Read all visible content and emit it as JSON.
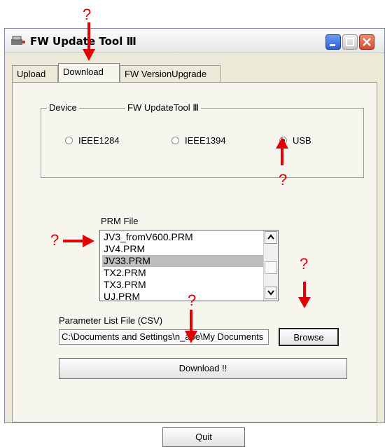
{
  "window": {
    "title": "FW Update Tool Ⅲ"
  },
  "tabs": [
    "Upload",
    "Download",
    "FW VersionUpgrade"
  ],
  "group": {
    "left_legend": "Device",
    "right_legend": "FW UpdateTool Ⅲ",
    "radios": [
      {
        "label": "IEEE1284",
        "checked": false
      },
      {
        "label": "IEEE1394",
        "checked": false
      },
      {
        "label": "USB",
        "checked": true
      }
    ]
  },
  "prm": {
    "label": "PRM File",
    "items": [
      "JV3_fromV600.PRM",
      "JV4.PRM",
      "JV33.PRM",
      "TX2.PRM",
      "TX3.PRM",
      "UJ.PRM"
    ],
    "selected": "JV33.PRM"
  },
  "param": {
    "label": "Parameter List File (CSV)",
    "path": "C:\\Documents and Settings\\n_abe\\My Documents"
  },
  "buttons": {
    "browse": "Browse",
    "download": "Download !!",
    "quit": "Quit"
  },
  "annotations": {
    "marker": "?",
    "color": "#e00000"
  }
}
